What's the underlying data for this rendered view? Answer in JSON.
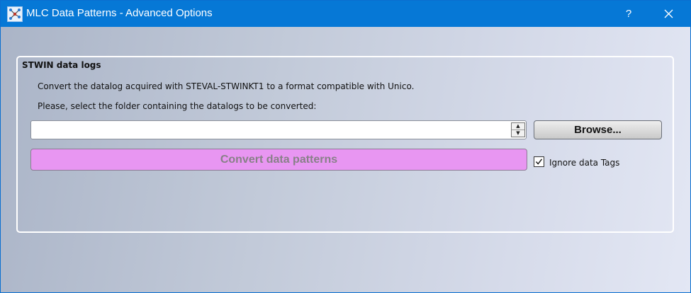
{
  "window": {
    "title": "MLC Data Patterns - Advanced Options",
    "help_label": "?",
    "app_icon": "network-icon",
    "close_icon": "close-icon"
  },
  "group": {
    "title": "STWIN data logs",
    "description": "Convert the datalog acquired with STEVAL-STWINKT1 to a format compatible with Unico.",
    "instruction": "Please, select the folder containing the datalogs to be converted:",
    "folder_input": {
      "value": "",
      "placeholder": ""
    },
    "browse_label": "Browse...",
    "convert_label": "Convert data patterns",
    "ignore_tags": {
      "label": "Ignore data Tags",
      "checked": true
    }
  },
  "colors": {
    "titlebar": "#0678d6",
    "convert_button": "#e896f2",
    "convert_text": "#888088"
  }
}
